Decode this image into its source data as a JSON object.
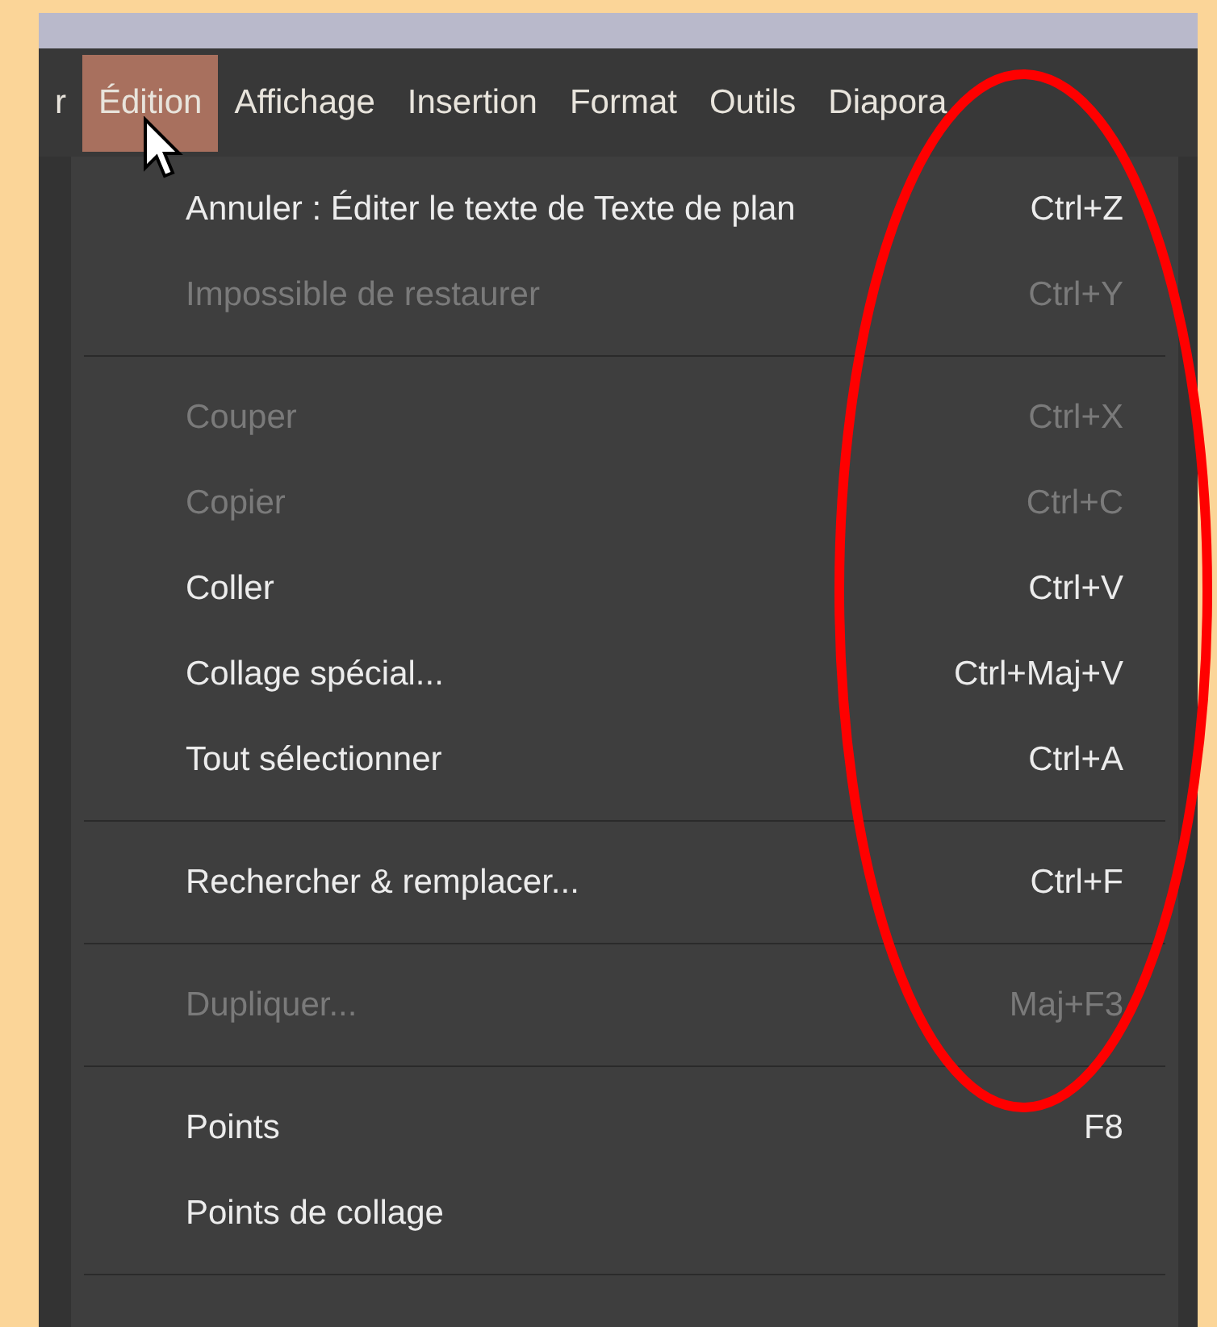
{
  "menubar": [
    {
      "label": "r",
      "selected": false
    },
    {
      "label": "Édition",
      "selected": true
    },
    {
      "label": "Affichage",
      "selected": false
    },
    {
      "label": "Insertion",
      "selected": false
    },
    {
      "label": "Format",
      "selected": false
    },
    {
      "label": "Outils",
      "selected": false
    },
    {
      "label": "Diapora",
      "selected": false
    }
  ],
  "menu": [
    {
      "kind": "item",
      "label": "Annuler : Éditer le texte de Texte de plan",
      "shortcut": "Ctrl+Z",
      "disabled": false
    },
    {
      "kind": "item",
      "label": "Impossible de restaurer",
      "shortcut": "Ctrl+Y",
      "disabled": true
    },
    {
      "kind": "separator"
    },
    {
      "kind": "item",
      "label": "Couper",
      "shortcut": "Ctrl+X",
      "disabled": true
    },
    {
      "kind": "item",
      "label": "Copier",
      "shortcut": "Ctrl+C",
      "disabled": true
    },
    {
      "kind": "item",
      "label": "Coller",
      "shortcut": "Ctrl+V",
      "disabled": false
    },
    {
      "kind": "item",
      "label": "Collage spécial...",
      "shortcut": "Ctrl+Maj+V",
      "disabled": false
    },
    {
      "kind": "item",
      "label": "Tout sélectionner",
      "shortcut": "Ctrl+A",
      "disabled": false
    },
    {
      "kind": "separator"
    },
    {
      "kind": "item",
      "label": "Rechercher & remplacer...",
      "shortcut": "Ctrl+F",
      "disabled": false
    },
    {
      "kind": "separator"
    },
    {
      "kind": "item",
      "label": "Dupliquer...",
      "shortcut": "Maj+F3",
      "disabled": true
    },
    {
      "kind": "separator"
    },
    {
      "kind": "item",
      "label": "Points",
      "shortcut": "F8",
      "disabled": false
    },
    {
      "kind": "item",
      "label": "Points de collage",
      "disabled": false
    },
    {
      "kind": "separator"
    }
  ]
}
